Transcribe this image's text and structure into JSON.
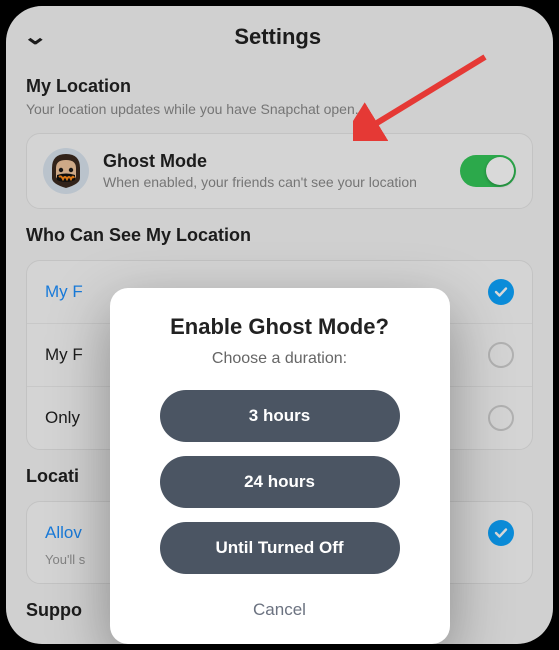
{
  "header": {
    "title": "Settings"
  },
  "myLocation": {
    "title": "My Location",
    "subtitle": "Your location updates while you have Snapchat open."
  },
  "ghostCard": {
    "title": "Ghost Mode",
    "subtitle": "When enabled, your friends can't see your location",
    "toggleOn": true
  },
  "whoSection": {
    "title": "Who Can See My Location",
    "rows": [
      {
        "label": "My F",
        "selected": true,
        "blue": true
      },
      {
        "label": "My F",
        "selected": false
      },
      {
        "label": "Only",
        "selected": false
      }
    ]
  },
  "locatiSection": {
    "title": "Locati",
    "row": {
      "label": "Allov",
      "sub": "You'll s",
      "checked": true
    }
  },
  "suppo": {
    "title": "Suppo"
  },
  "modal": {
    "title": "Enable Ghost Mode?",
    "subtitle": "Choose a duration:",
    "options": [
      "3 hours",
      "24 hours",
      "Until Turned Off"
    ],
    "cancel": "Cancel"
  },
  "colors": {
    "toggleOn": "#34c759",
    "check": "#0ea5ff",
    "arrow": "#e53935",
    "modalBtn": "#4b5563"
  }
}
